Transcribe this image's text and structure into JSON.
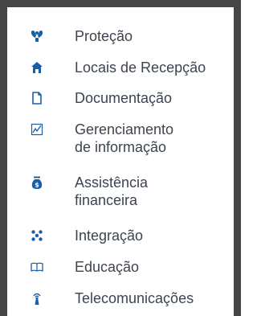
{
  "theme": {
    "accent": "#1a5ea8",
    "text": "#3c4450",
    "frame": "#454545"
  },
  "menu": {
    "items": [
      {
        "icon": "protection-icon",
        "label": "Proteção"
      },
      {
        "icon": "house-icon",
        "label": "Locais de Recepção"
      },
      {
        "icon": "document-icon",
        "label": "Documentação"
      },
      {
        "icon": "line-chart-icon",
        "label_line1": "Gerenciamento",
        "label_line2": "de informação"
      },
      {
        "icon": "money-bag-icon",
        "label_line1": "Assistência",
        "label_line2": "financeira"
      },
      {
        "icon": "network-dots-icon",
        "label": "Integração"
      },
      {
        "icon": "open-book-icon",
        "label": "Educação"
      },
      {
        "icon": "telecom-icon",
        "label": "Telecomunicações"
      }
    ]
  }
}
